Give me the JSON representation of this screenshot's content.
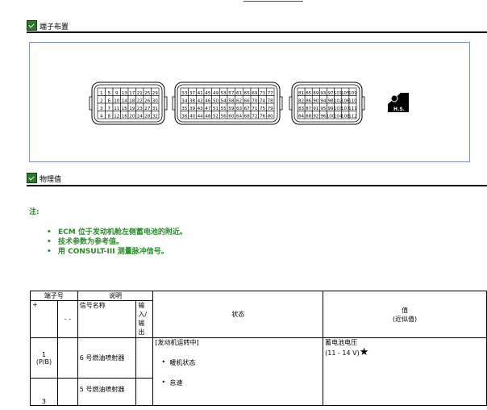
{
  "sections": {
    "terminal_layout": "端子布置",
    "physical_values": "物理值"
  },
  "note": {
    "label": "注:",
    "items": [
      "ECM 位于发动机舱左侧蓄电池的附近。",
      "技术参数为参考值。",
      "用  CONSULT-III 测量脉冲信号。"
    ]
  },
  "connectors": {
    "left": [
      [
        "1",
        "5",
        "9",
        "13",
        "17",
        "21",
        "25",
        "29"
      ],
      [
        "2",
        "6",
        "10",
        "14",
        "18",
        "22",
        "26",
        "30"
      ],
      [
        "3",
        "7",
        "11",
        "15",
        "19",
        "23",
        "27",
        "31"
      ],
      [
        "4",
        "8",
        "12",
        "16",
        "20",
        "24",
        "28",
        "32"
      ]
    ],
    "middle": [
      [
        "33",
        "37",
        "41",
        "45",
        "49",
        "53",
        "57",
        "61",
        "65",
        "69",
        "73",
        "77"
      ],
      [
        "34",
        "38",
        "42",
        "46",
        "50",
        "54",
        "58",
        "62",
        "66",
        "70",
        "74",
        "78"
      ],
      [
        "35",
        "39",
        "43",
        "47",
        "51",
        "55",
        "59",
        "63",
        "67",
        "71",
        "75",
        "79"
      ],
      [
        "36",
        "40",
        "44",
        "48",
        "52",
        "56",
        "60",
        "64",
        "68",
        "72",
        "76",
        "80"
      ]
    ],
    "right": [
      [
        "81",
        "85",
        "89",
        "93",
        "97",
        "101",
        "105",
        "109"
      ],
      [
        "82",
        "86",
        "90",
        "94",
        "98",
        "102",
        "106",
        "110"
      ],
      [
        "83",
        "87",
        "91",
        "95",
        "99",
        "103",
        "107",
        "111"
      ],
      [
        "84",
        "88",
        "92",
        "96",
        "100",
        "104",
        "108",
        "112"
      ]
    ],
    "hs_label": "H.S."
  },
  "table": {
    "headers": {
      "terminal_no": "端子号",
      "description": "说明",
      "plus": "+",
      "minus": "- -",
      "signal_name": "信号名称",
      "io": "输入/输出",
      "condition": "状态",
      "value": "值",
      "value_sub": "(近似值)"
    },
    "rows": [
      {
        "terminal": "1",
        "terminal_sub": "(P/B)",
        "signal": "6 号燃油喷射器",
        "condition_main": "[发动机运转中]",
        "condition_sub": "暖机状态",
        "value_main": "蓄电池电压",
        "value_sub": "(11 - 14 V)"
      },
      {
        "terminal": "3",
        "signal": "5 号燃油喷射器",
        "condition_sub": "怠速"
      }
    ],
    "star": "★"
  }
}
